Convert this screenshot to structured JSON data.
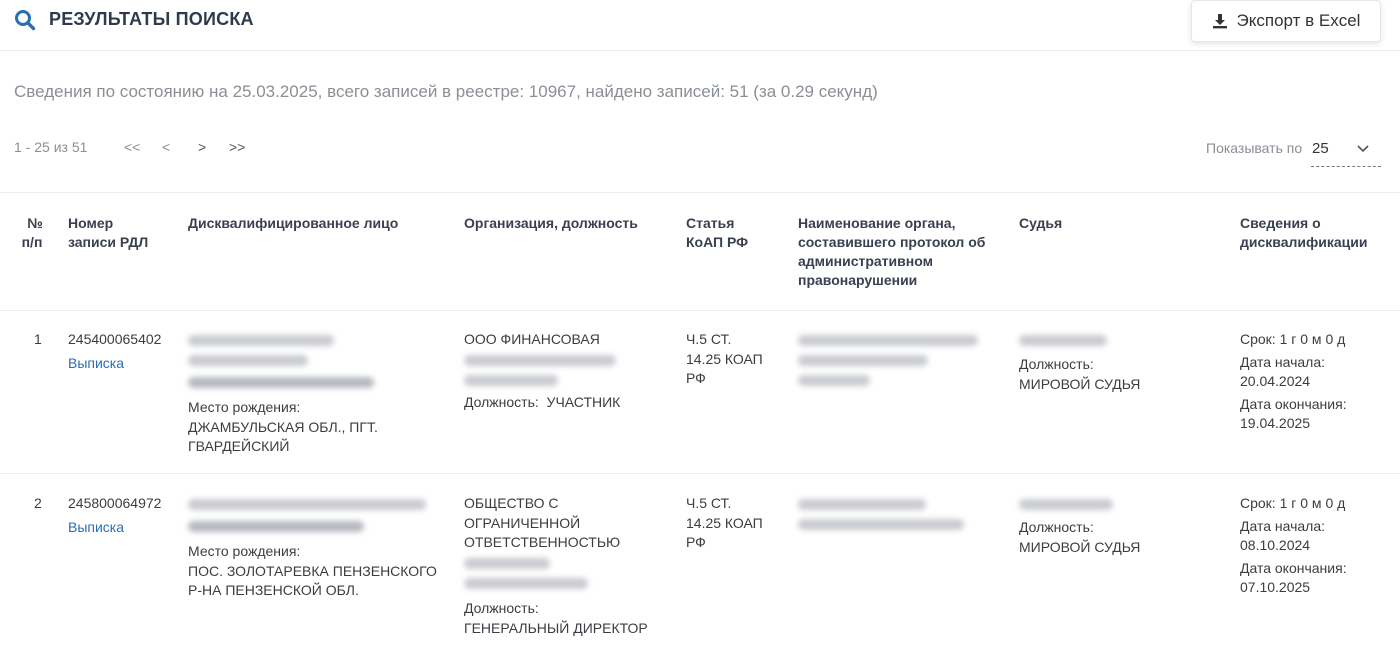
{
  "header": {
    "title": "РЕЗУЛЬТАТЫ ПОИСКА",
    "export_label": "Экспорт в Excel"
  },
  "info_text": "Сведения по состоянию на 25.03.2025, всего записей в реестре: 10967, найдено записей: 51 (за 0.29 секунд)",
  "pagination": {
    "range": "1 - 25 из 51",
    "first": "<<",
    "prev": "<",
    "next": ">",
    "last": ">>",
    "page_size_label": "Показывать по",
    "page_size_value": "25"
  },
  "columns": [
    [
      "№",
      "п/п"
    ],
    [
      "Номер",
      "записи РДЛ"
    ],
    [
      "Дисквалифицированное лицо"
    ],
    [
      "Организация, должность"
    ],
    [
      "Статья",
      "КоАП РФ"
    ],
    [
      "Наименование органа,",
      "составившего протокол об",
      "административном",
      "правонарушении"
    ],
    [
      "Судья"
    ],
    [
      "Сведения о",
      "дисквалификации"
    ]
  ],
  "rows": [
    {
      "num": "1",
      "record_no": "245400065402",
      "link": "Выписка",
      "birthplace_label": "Место рождения:",
      "birthplace": [
        "ДЖАМБУЛЬСКАЯ ОБЛ., ПГТ.",
        "ГВАРДЕЙСКИЙ"
      ],
      "org": [
        "ООО ФИНАНСОВАЯ"
      ],
      "position_label": "Должность:",
      "position": "УЧАСТНИК",
      "article": [
        "Ч.5 СТ.",
        "14.25 КОАП",
        "РФ"
      ],
      "judge_position_label": "Должность:",
      "judge_position": "МИРОВОЙ СУДЬЯ",
      "term": "Срок: 1 г 0 м 0 д",
      "start_label": "Дата начала:",
      "start": "20.04.2024",
      "end_label": "Дата окончания:",
      "end": "19.04.2025"
    },
    {
      "num": "2",
      "record_no": "245800064972",
      "link": "Выписка",
      "birthplace_label": "Место рождения:",
      "birthplace": [
        "ПОС. ЗОЛОТАРЕВКА ПЕНЗЕНСКОГО",
        "Р-НА ПЕНЗЕНСКОЙ ОБЛ."
      ],
      "org": [
        "ОБЩЕСТВО С",
        "ОГРАНИЧЕННОЙ",
        "ОТВЕТСТВЕННОСТЬЮ"
      ],
      "position_label": "Должность:",
      "position": "ГЕНЕРАЛЬНЫЙ ДИРЕКТОР",
      "article": [
        "Ч.5 СТ.",
        "14.25 КОАП",
        "РФ"
      ],
      "judge_position_label": "Должность:",
      "judge_position": "МИРОВОЙ СУДЬЯ",
      "term": "Срок: 1 г 0 м 0 д",
      "start_label": "Дата начала:",
      "start": "08.10.2024",
      "end_label": "Дата окончания:",
      "end": "07.10.2025"
    }
  ]
}
